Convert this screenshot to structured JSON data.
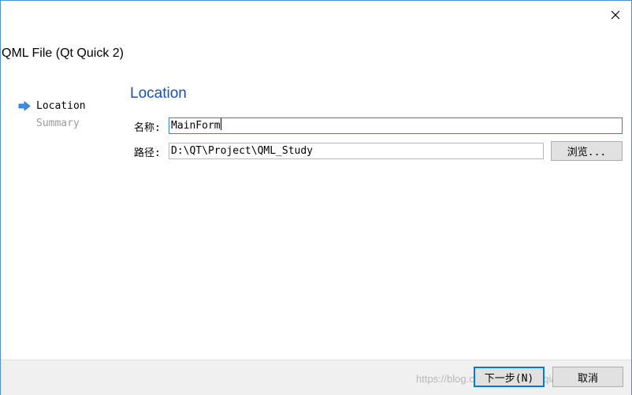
{
  "dialog": {
    "title": "QML File (Qt Quick 2)",
    "close_icon": "close-icon"
  },
  "steps": [
    {
      "label": "Location",
      "active": true
    },
    {
      "label": "Summary",
      "active": false
    }
  ],
  "page": {
    "heading": "Location",
    "name_label": "名称:",
    "name_value": "MainForm",
    "path_label": "路径:",
    "path_value": "D:\\QT\\Project\\QML_Study",
    "browse_label": "浏览..."
  },
  "footer": {
    "next_label": "下一步(N)",
    "cancel_label": "取消",
    "watermark": "https://blog.csdn.net/zhujianqiangqq"
  },
  "colors": {
    "accent": "#0078d7",
    "heading": "#1f4fa8",
    "step_arrow": "#3f8ce0"
  }
}
